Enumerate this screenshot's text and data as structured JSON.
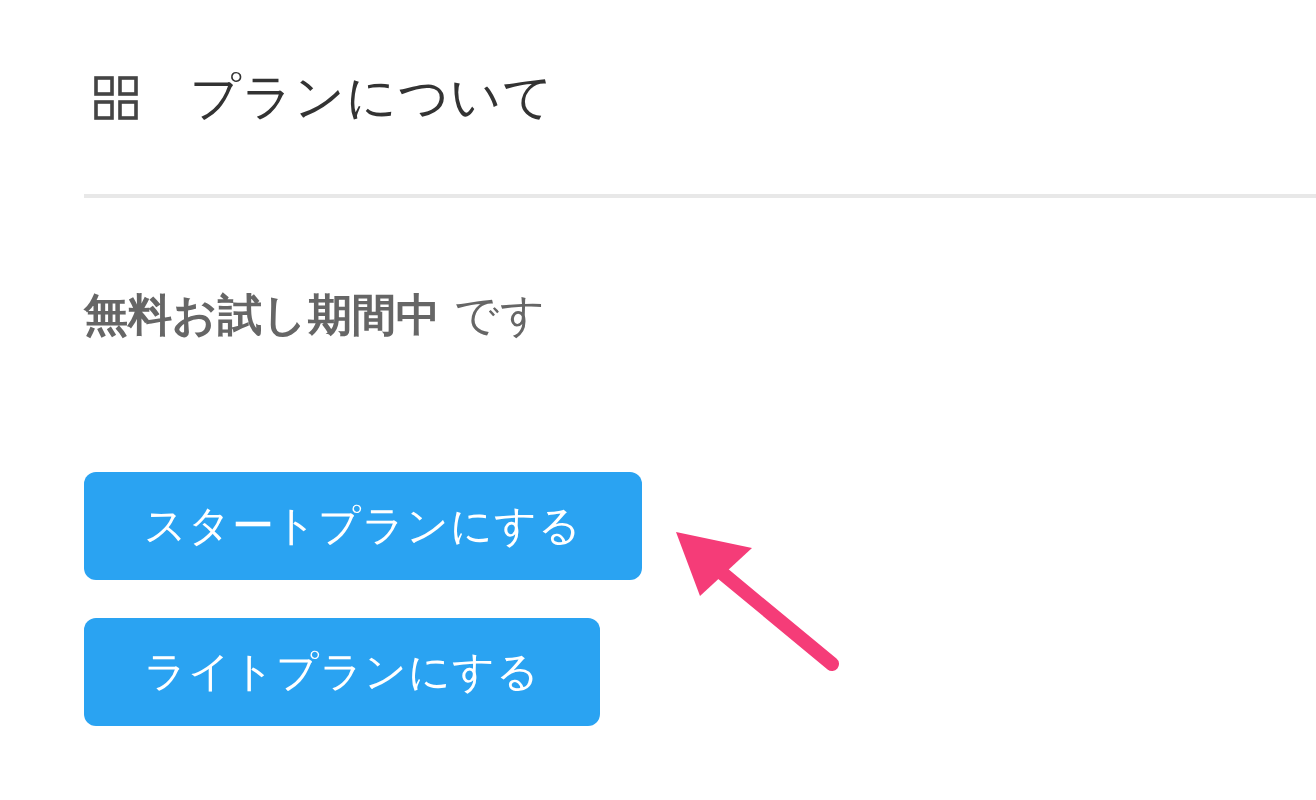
{
  "header": {
    "title": "プランについて"
  },
  "status": {
    "text": "**無料お試し期間中** です"
  },
  "buttons": [
    {
      "label": "スタートプランにする"
    },
    {
      "label": "ライトプランにする"
    }
  ]
}
